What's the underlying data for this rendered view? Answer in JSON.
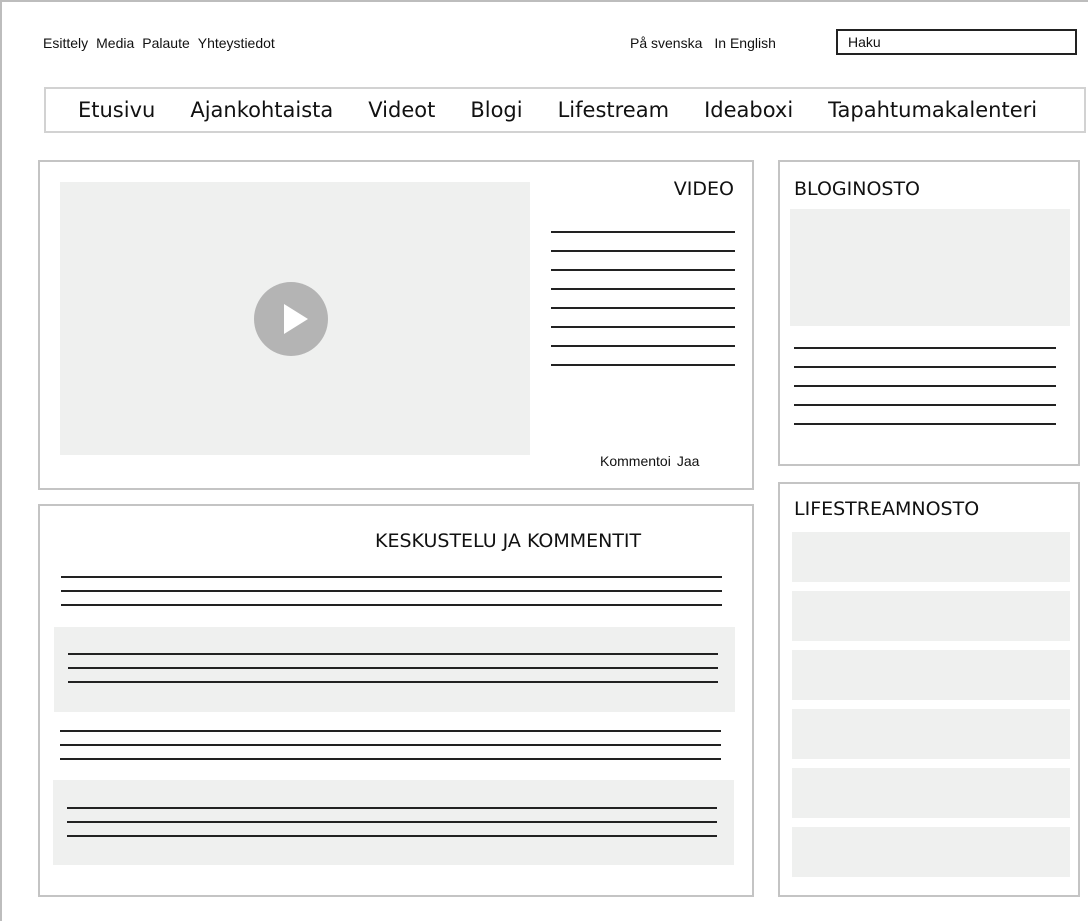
{
  "utility_nav": [
    "Esittely",
    "Media",
    "Palaute",
    "Yhteystiedot"
  ],
  "language_links": [
    "På svenska",
    "In English"
  ],
  "search": {
    "placeholder": "Haku"
  },
  "main_nav": [
    "Etusivu",
    "Ajankohtaista",
    "Videot",
    "Blogi",
    "Lifestream",
    "Ideaboxi",
    "Tapahtumakalenteri"
  ],
  "video": {
    "title": "VIDEO",
    "actions": [
      "Kommentoi",
      "Jaa"
    ]
  },
  "blog": {
    "title": "BLOGINOSTO"
  },
  "lifestream": {
    "title": "LIFESTREAMNOSTO"
  },
  "comments": {
    "title": "KESKUSTELU JA KOMMENTIT"
  }
}
